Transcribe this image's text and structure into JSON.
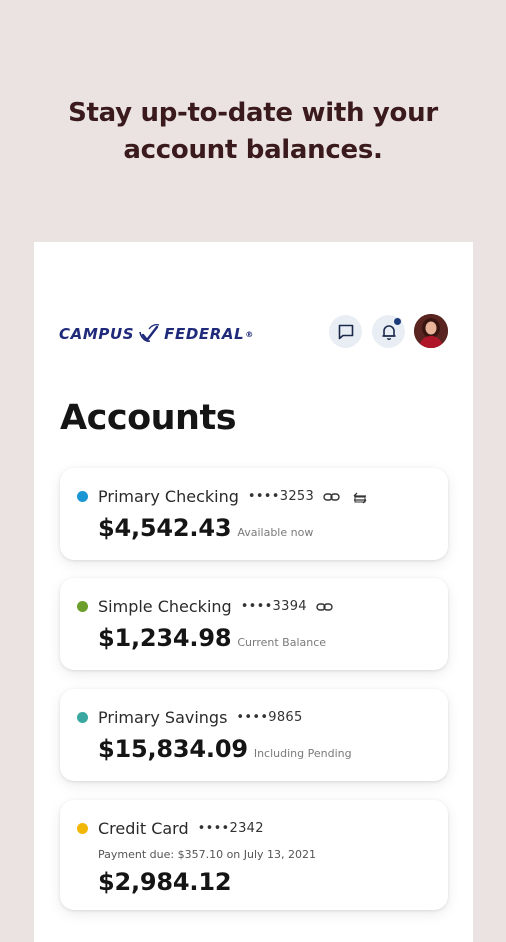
{
  "headline": {
    "line1": "Stay up-to-date with your",
    "line2": "account balances."
  },
  "header": {
    "logo_left": "CAMPUS",
    "logo_right": "FEDERAL",
    "logo_reg": "®",
    "icons": [
      "chat-icon",
      "bell-icon",
      "avatar"
    ]
  },
  "page_title": "Accounts",
  "accounts": [
    {
      "name": "Primary Checking",
      "number": "••••3253",
      "amount": "$4,542.43",
      "note": "Available now",
      "dot_color": "#1a96d4",
      "icons": [
        "link-icon",
        "transfer-icon"
      ]
    },
    {
      "name": "Simple Checking",
      "number": "••••3394",
      "amount": "$1,234.98",
      "note": "Current Balance",
      "dot_color": "#6b9e2a",
      "icons": [
        "link-icon"
      ]
    },
    {
      "name": "Primary Savings",
      "number": "••••9865",
      "amount": "$15,834.09",
      "note": "Including Pending",
      "dot_color": "#3aa8a0",
      "icons": []
    },
    {
      "name": "Credit Card",
      "number": "••••2342",
      "amount": "$2,984.12",
      "note": "",
      "due": "Payment due: $357.10 on July 13, 2021",
      "dot_color": "#f2b705",
      "icons": []
    }
  ],
  "colors": {
    "background": "#ebe3e1",
    "headline": "#3a1a1c",
    "brand": "#1f2a7a"
  }
}
